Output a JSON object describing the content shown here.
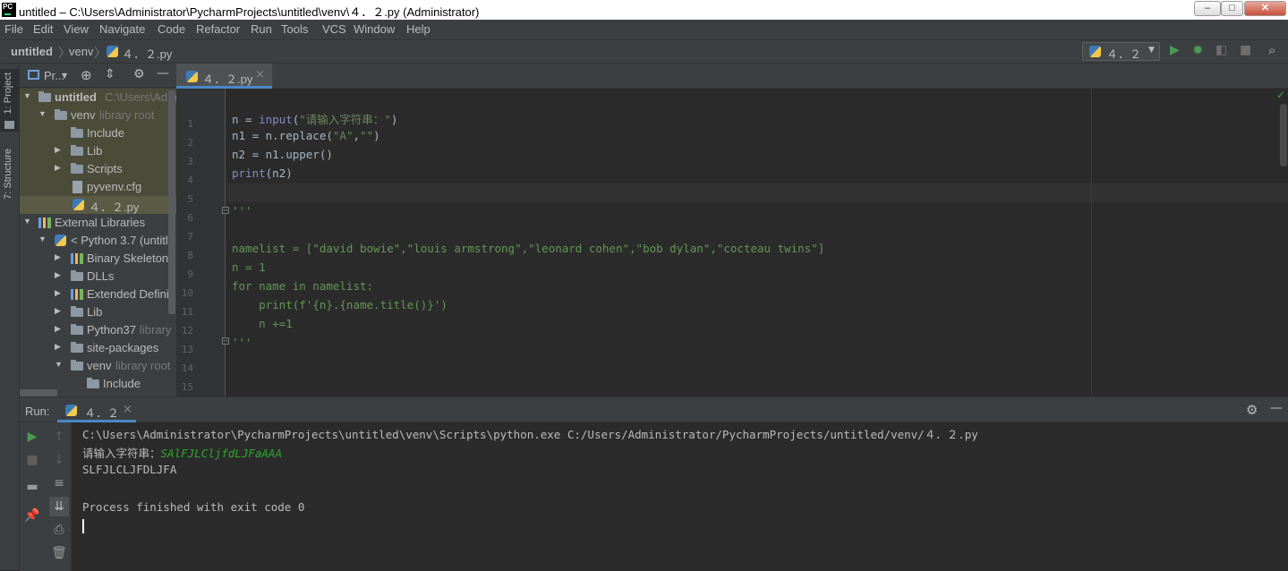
{
  "window": {
    "title": "untitled – C:\\Users\\Administrator\\PycharmProjects\\untitled\\venv\\４．２.py (Administrator)",
    "icon_label": "PC",
    "buttons": [
      "–",
      "□",
      "✕"
    ]
  },
  "menu": [
    "File",
    "Edit",
    "View",
    "Navigate",
    "Code",
    "Refactor",
    "Run",
    "Tools",
    "VCS",
    "Window",
    "Help"
  ],
  "breadcrumb": [
    "untitled",
    "venv",
    "４．２.py"
  ],
  "run_config": "４．２",
  "left_tabs": [
    "1: Project",
    "7: Structure"
  ],
  "project_panel": {
    "title": "Pr...",
    "tree": [
      {
        "label": "untitled",
        "hint": "C:\\Users\\Adm",
        "bold": true
      },
      {
        "label": "venv",
        "hint": "library root"
      },
      {
        "label": "Include",
        "hint": ""
      },
      {
        "label": "Lib",
        "hint": ""
      },
      {
        "label": "Scripts",
        "hint": ""
      },
      {
        "label": "pyvenv.cfg",
        "hint": ""
      },
      {
        "label": "４．２.py",
        "hint": ""
      },
      {
        "label": "External Libraries",
        "hint": ""
      },
      {
        "label": "< Python 3.7 (untitle",
        "hint": ""
      },
      {
        "label": "Binary Skeletons",
        "hint": ""
      },
      {
        "label": "DLLs",
        "hint": ""
      },
      {
        "label": "Extended Definiti",
        "hint": ""
      },
      {
        "label": "Lib",
        "hint": ""
      },
      {
        "label": "Python37",
        "hint": "library"
      },
      {
        "label": "site-packages",
        "hint": ""
      },
      {
        "label": "venv",
        "hint": "library root"
      },
      {
        "label": "Include",
        "hint": ""
      }
    ]
  },
  "editor": {
    "tab": "４．２.py",
    "tab_close": "×",
    "line_numbers": [
      "1",
      "2",
      "3",
      "4",
      "5",
      "6",
      "7",
      "8",
      "9",
      "10",
      "11",
      "12",
      "13",
      "14",
      "15"
    ],
    "lines": [
      "",
      "n = input(\"请输入字符串：\")",
      "n1 = n.replace(\"A\",\"\")",
      "n2 = n1.upper()",
      "print(n2)",
      "",
      "'''",
      "",
      "namelist = [\"david bowie\",\"louis armstrong\",\"leonard cohen\",\"bob dylan\",\"cocteau twins\"]",
      "n = 1",
      "for name in namelist:",
      "    print(f'{n}.{name.title()}')",
      "    n +=1",
      "'''",
      ""
    ]
  },
  "run_panel": {
    "label": "Run:",
    "tab": "４．２",
    "tab_close": "×",
    "output": {
      "command": "C:\\Users\\Administrator\\PycharmProjects\\untitled\\venv\\Scripts\\python.exe C:/Users/Administrator/PycharmProjects/untitled/venv/４．２.py",
      "prompt": "请输入字符串：",
      "user_input": "SAlFJLCljfdLJFaAAA",
      "result": "SLFJLCLJFDLJFA",
      "exit": "Process finished with exit code 0"
    }
  },
  "colors": {
    "keyword": "#cc7832",
    "string": "#6a8759",
    "builtin": "#8888c6",
    "default": "#a9b7c6",
    "comment_block": "#629755",
    "user_input": "#2ba82b"
  }
}
